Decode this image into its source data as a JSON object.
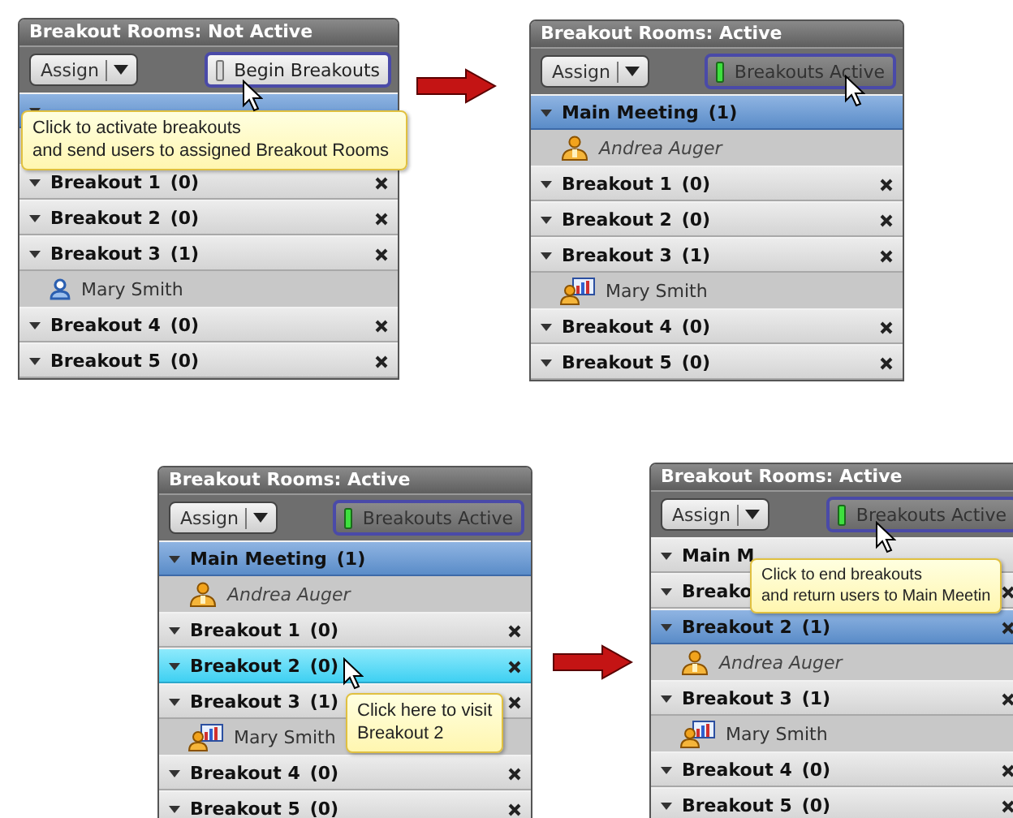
{
  "panels": [
    {
      "title": "Breakout Rooms: Not Active",
      "assign_label": "Assign",
      "toggle": {
        "label": "Begin Breakouts",
        "active": false
      },
      "tooltip": "Click to activate breakouts\nand send users to assigned Breakout Rooms",
      "rows": [
        {
          "kind": "main",
          "expanded": true,
          "selected": true,
          "hovered": false
        },
        {
          "kind": "blank"
        },
        {
          "kind": "breakout",
          "name": "Breakout 1",
          "count": "(0)",
          "expanded": true,
          "selected": false,
          "hovered": false
        },
        {
          "kind": "breakout",
          "name": "Breakout 2",
          "count": "(0)",
          "expanded": true,
          "selected": false,
          "hovered": false
        },
        {
          "kind": "breakout",
          "name": "Breakout 3",
          "count": "(1)",
          "expanded": true,
          "selected": false,
          "hovered": false
        },
        {
          "kind": "attendee",
          "name": "Mary Smith"
        },
        {
          "kind": "breakout",
          "name": "Breakout 4",
          "count": "(0)",
          "expanded": true,
          "selected": false,
          "hovered": false
        },
        {
          "kind": "breakout",
          "name": "Breakout 5",
          "count": "(0)",
          "expanded": true,
          "selected": false,
          "hovered": false
        }
      ]
    },
    {
      "title": "Breakout Rooms: Active",
      "assign_label": "Assign",
      "toggle": {
        "label": "Breakouts Active",
        "active": true
      },
      "rows": [
        {
          "kind": "main",
          "name": "Main Meeting",
          "count": "(1)",
          "expanded": true,
          "selected": true,
          "hovered": false
        },
        {
          "kind": "host",
          "name": "Andrea Auger"
        },
        {
          "kind": "breakout",
          "name": "Breakout 1",
          "count": "(0)",
          "expanded": true,
          "selected": false,
          "hovered": false
        },
        {
          "kind": "breakout",
          "name": "Breakout 2",
          "count": "(0)",
          "expanded": true,
          "selected": false,
          "hovered": false
        },
        {
          "kind": "breakout",
          "name": "Breakout 3",
          "count": "(1)",
          "expanded": true,
          "selected": false,
          "hovered": false
        },
        {
          "kind": "presenter",
          "name": "Mary Smith"
        },
        {
          "kind": "breakout",
          "name": "Breakout 4",
          "count": "(0)",
          "expanded": true,
          "selected": false,
          "hovered": false
        },
        {
          "kind": "breakout",
          "name": "Breakout 5",
          "count": "(0)",
          "expanded": true,
          "selected": false,
          "hovered": false
        }
      ]
    },
    {
      "title": "Breakout Rooms: Active",
      "assign_label": "Assign",
      "toggle": {
        "label": "Breakouts Active",
        "active": true
      },
      "tooltip": "Click here to visit\nBreakout 2",
      "rows": [
        {
          "kind": "main",
          "name": "Main Meeting",
          "count": "(1)",
          "expanded": true,
          "selected": true,
          "hovered": false
        },
        {
          "kind": "host",
          "name": "Andrea Auger"
        },
        {
          "kind": "breakout",
          "name": "Breakout 1",
          "count": "(0)",
          "expanded": true,
          "selected": false,
          "hovered": false
        },
        {
          "kind": "breakout",
          "name": "Breakout 2",
          "count": "(0)",
          "expanded": true,
          "selected": false,
          "hovered": true
        },
        {
          "kind": "breakout",
          "name": "Breakout 3",
          "count": "(1)",
          "expanded": true,
          "selected": false,
          "hovered": false
        },
        {
          "kind": "presenter",
          "name": "Mary Smith"
        },
        {
          "kind": "breakout",
          "name": "Breakout 4",
          "count": "(0)",
          "expanded": true,
          "selected": false,
          "hovered": false
        },
        {
          "kind": "breakout",
          "name": "Breakout 5",
          "count": "(0)",
          "expanded": true,
          "selected": false,
          "hovered": false
        }
      ]
    },
    {
      "title": "Breakout Rooms: Active",
      "assign_label": "Assign",
      "toggle": {
        "label": "Breakouts Active",
        "active": true
      },
      "tooltip": "Click to end breakouts\nand return users to Main Meetin",
      "rows": [
        {
          "kind": "main",
          "name": "Main M",
          "expanded": true,
          "selected": false,
          "hovered": false
        },
        {
          "kind": "breakout",
          "name": "Breako",
          "expanded": true,
          "selected": false,
          "hovered": false
        },
        {
          "kind": "breakout",
          "name": "Breakout 2",
          "count": "(1)",
          "expanded": true,
          "selected": true,
          "hovered": false
        },
        {
          "kind": "host",
          "name": "Andrea Auger"
        },
        {
          "kind": "breakout",
          "name": "Breakout 3",
          "count": "(1)",
          "expanded": true,
          "selected": false,
          "hovered": false
        },
        {
          "kind": "presenter",
          "name": "Mary Smith"
        },
        {
          "kind": "breakout",
          "name": "Breakout 4",
          "count": "(0)",
          "expanded": true,
          "selected": false,
          "hovered": false
        },
        {
          "kind": "breakout",
          "name": "Breakout 5",
          "count": "(0)",
          "expanded": true,
          "selected": false,
          "hovered": false
        }
      ]
    }
  ]
}
